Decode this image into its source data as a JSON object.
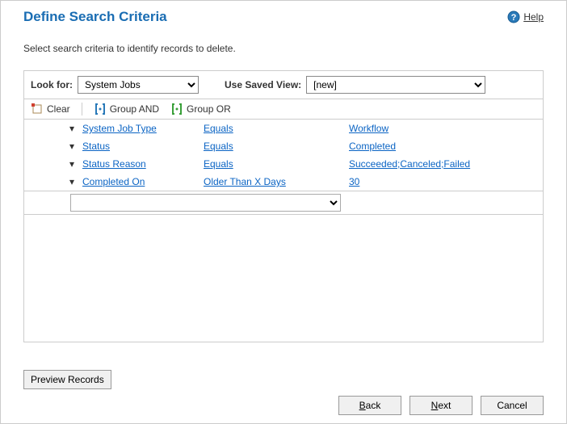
{
  "title": "Define Search Criteria",
  "help_label": "Help",
  "instruction": "Select search criteria to identify records to delete.",
  "look_for_label": "Look for:",
  "look_for_value": "System Jobs",
  "saved_view_label": "Use Saved View:",
  "saved_view_value": "[new]",
  "toolbar": {
    "clear": "Clear",
    "group_and": "Group AND",
    "group_or": "Group OR"
  },
  "criteria": {
    "rows": [
      {
        "field": "System Job Type",
        "op": "Equals",
        "val": "Workflow"
      },
      {
        "field": "Status",
        "op": "Equals",
        "val": "Completed"
      },
      {
        "field": "Status Reason",
        "op": "Equals",
        "val": "Succeeded;Canceled;Failed"
      },
      {
        "field": "Completed On",
        "op": "Older Than X Days",
        "val": "30"
      }
    ]
  },
  "buttons": {
    "preview": "Preview Records",
    "back": "Back",
    "next": "Next",
    "cancel": "Cancel"
  }
}
